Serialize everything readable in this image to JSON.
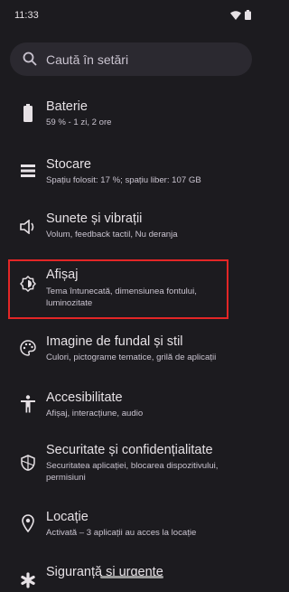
{
  "status_bar": {
    "time": "11:33",
    "icons": [
      "wifi-icon",
      "battery-icon"
    ]
  },
  "search": {
    "placeholder": "Caută în setări",
    "icon": "search-icon"
  },
  "settings": [
    {
      "title": "Baterie",
      "subtitle": "59 % - 1 zi, 2 ore",
      "icon": "battery-icon"
    },
    {
      "title": "Stocare",
      "subtitle": "Spațiu folosit: 17 %; spațiu liber: 107 GB",
      "icon": "storage-icon"
    },
    {
      "title": "Sunete și vibrații",
      "subtitle": "Volum, feedback tactil, Nu deranja",
      "icon": "sound-icon"
    },
    {
      "title": "Afișaj",
      "subtitle": "Tema întunecată, dimensiunea fontului, luminozitate",
      "icon": "display-icon"
    },
    {
      "title": "Imagine de fundal și stil",
      "subtitle": "Culori, pictograme tematice, grilă de aplicații",
      "icon": "palette-icon"
    },
    {
      "title": "Accesibilitate",
      "subtitle": "Afișaj, interacțiune, audio",
      "icon": "accessibility-icon"
    },
    {
      "title": "Securitate și confidențialitate",
      "subtitle": "Securitatea aplicației, blocarea dispozitivului, permisiuni",
      "icon": "shield-icon"
    },
    {
      "title": "Locație",
      "subtitle": "Activată – 3 aplicații au acces la locație",
      "icon": "location-icon"
    },
    {
      "title": "Siguranță și urgențe",
      "subtitle": "",
      "icon": "emergency-icon"
    }
  ],
  "colors": {
    "background": "#1c1b1f",
    "search_background": "#2b2930",
    "highlight": "#e32626",
    "text_primary": "#e6e1e5",
    "text_secondary": "#cac4d0"
  }
}
